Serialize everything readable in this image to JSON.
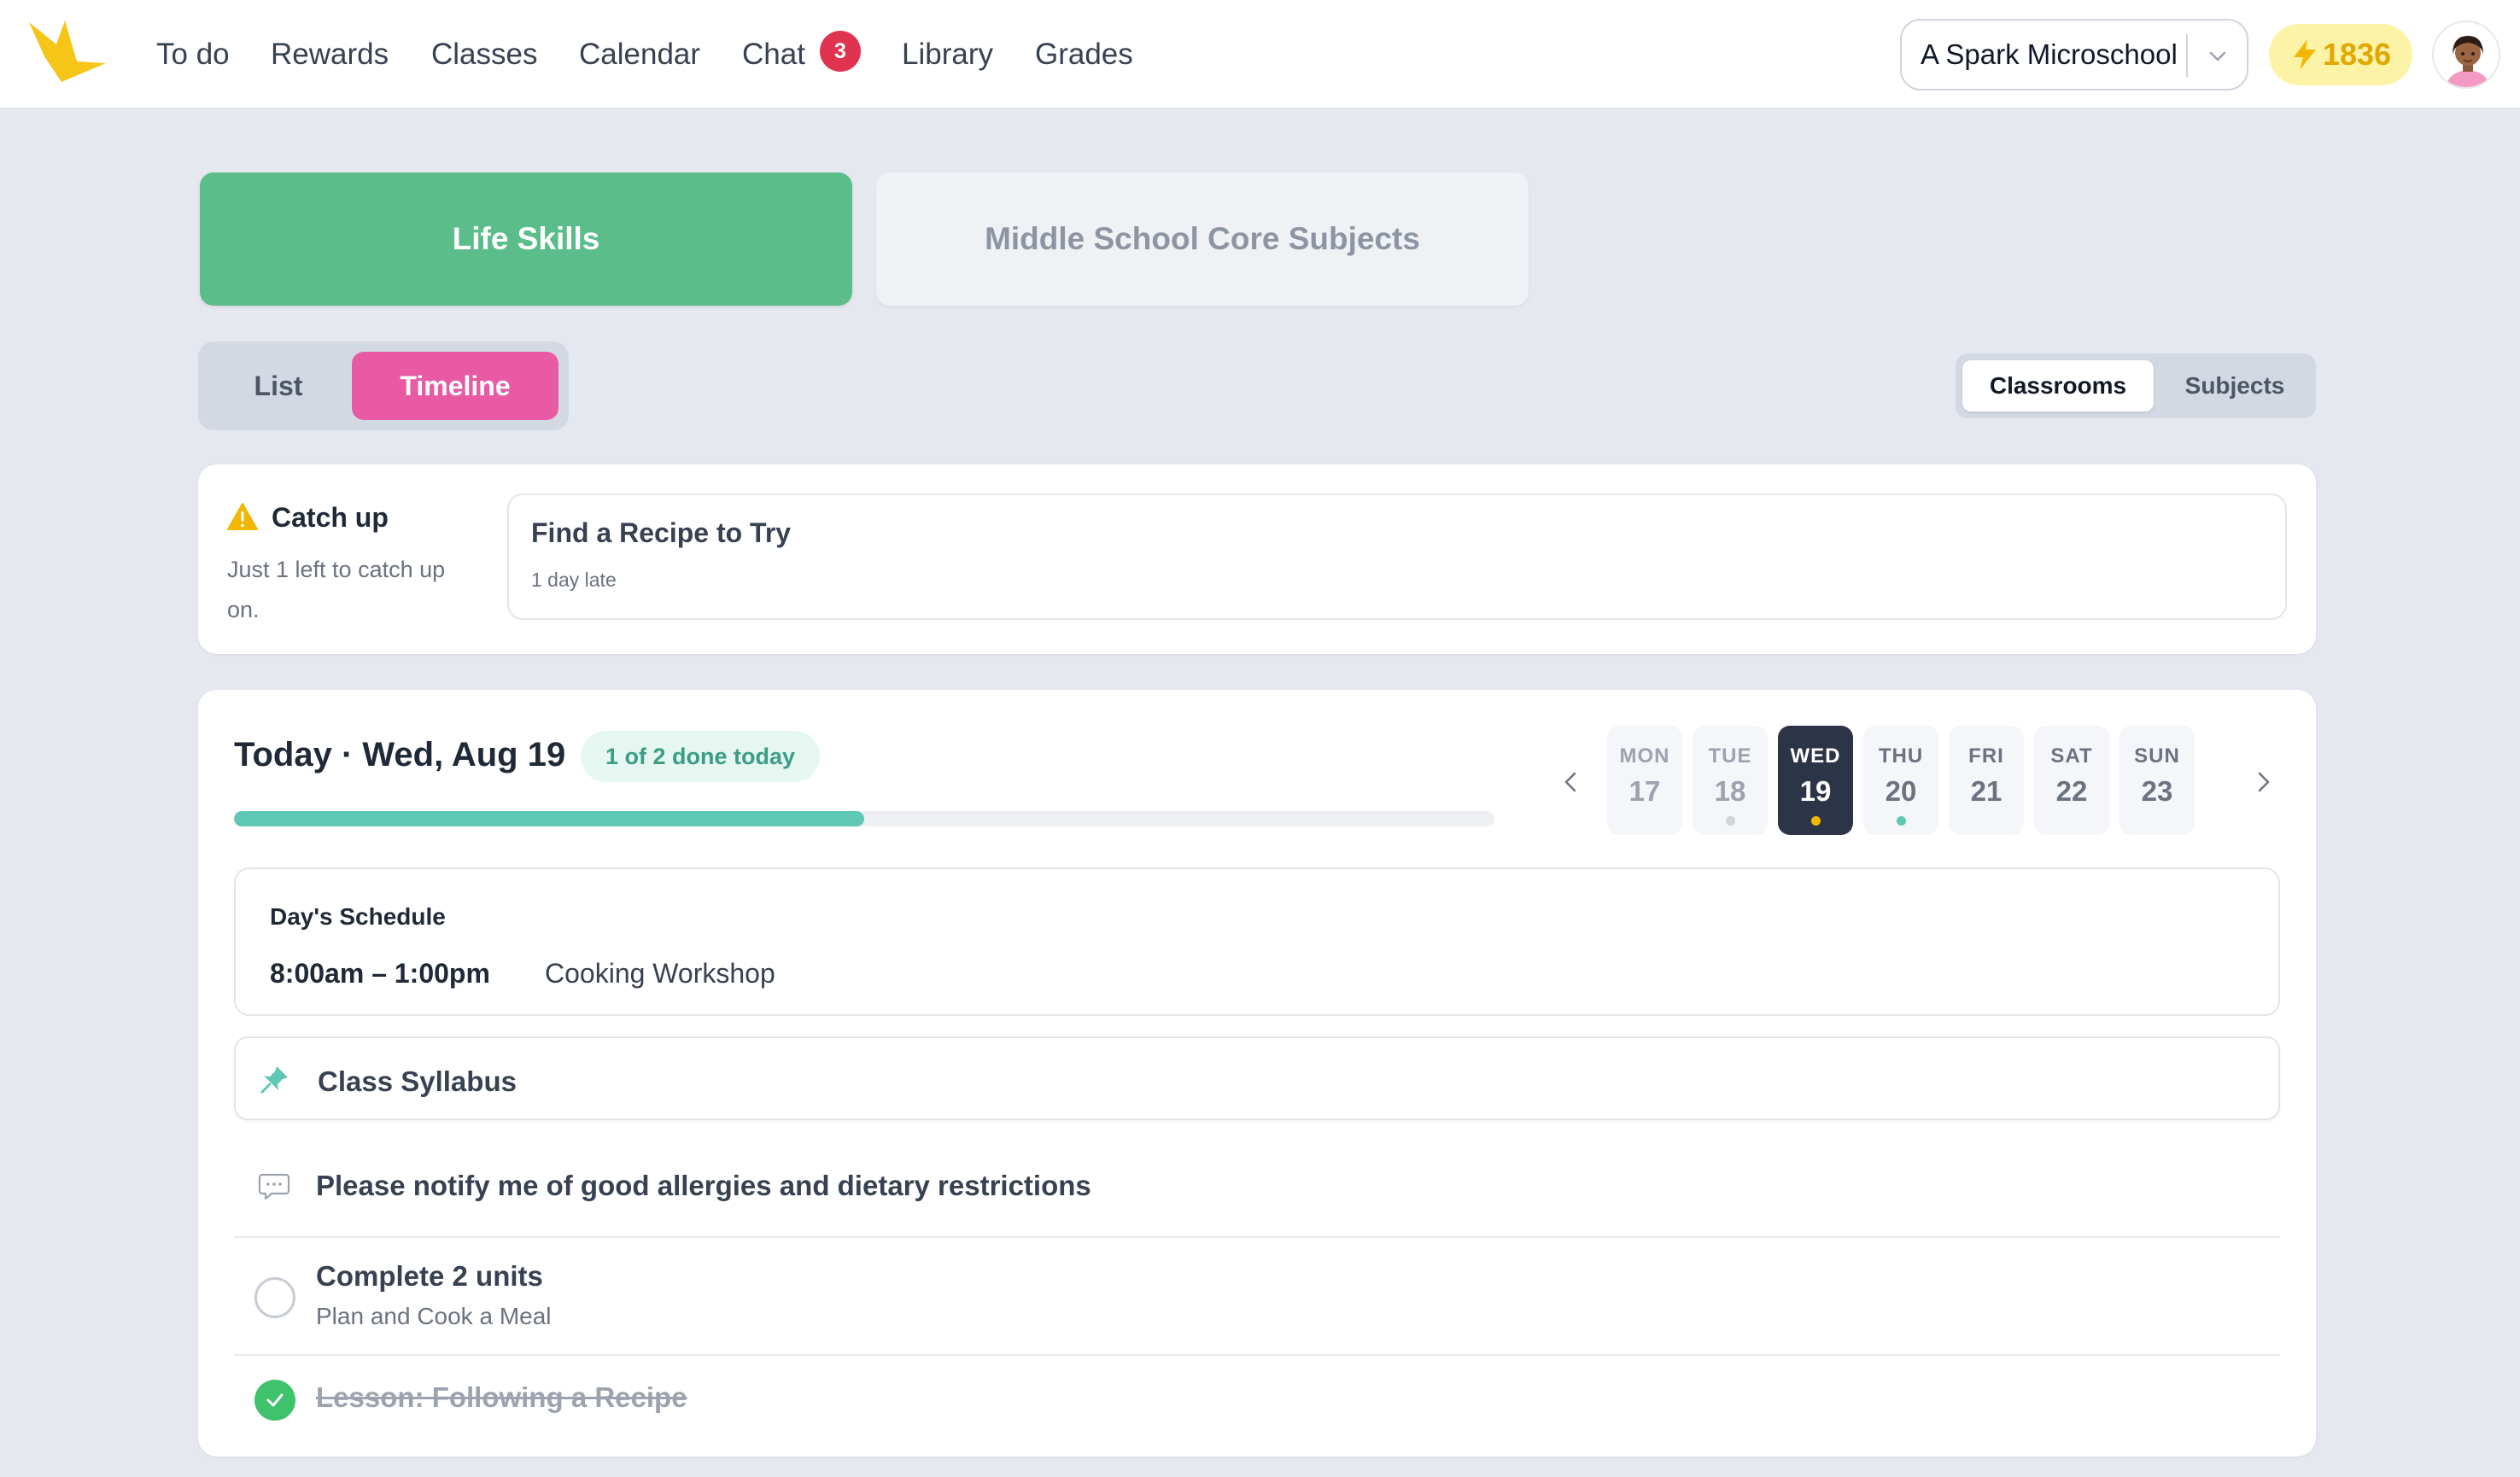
{
  "nav": {
    "items": [
      {
        "label": "To do"
      },
      {
        "label": "Rewards"
      },
      {
        "label": "Classes"
      },
      {
        "label": "Calendar"
      },
      {
        "label": "Chat",
        "badge": "3"
      },
      {
        "label": "Library"
      },
      {
        "label": "Grades"
      }
    ],
    "school_selector": "A Spark Microschool",
    "points": "1836",
    "colors": {
      "brand": "#f5c518",
      "badge": "#e0334f",
      "points_bg": "#fdf3a6",
      "points_text": "#e0a800"
    }
  },
  "programs": {
    "active": "Life Skills",
    "inactive": "Middle School Core Subjects",
    "active_color": "#5abd8a"
  },
  "view_toggle": {
    "list": "List",
    "timeline": "Timeline",
    "selected": "Timeline",
    "accent": "#e85aa4"
  },
  "group_toggle": {
    "classrooms": "Classrooms",
    "subjects": "Subjects",
    "selected": "Classrooms"
  },
  "catch_up": {
    "title": "Catch up",
    "description": "Just 1 left to catch up on.",
    "icon": "warning-icon",
    "item": {
      "title": "Find a Recipe to Try",
      "status": "1 day late"
    }
  },
  "today": {
    "title": "Today · Wed, Aug 19",
    "done_badge": "1 of 2 done today",
    "progress": 0.5,
    "days": [
      {
        "name": "MON",
        "num": "17",
        "state": "past",
        "dot": null
      },
      {
        "name": "TUE",
        "num": "18",
        "state": "past",
        "dot": "#d1d5db"
      },
      {
        "name": "WED",
        "num": "19",
        "state": "selected",
        "dot": "#f5b800"
      },
      {
        "name": "THU",
        "num": "20",
        "state": "future",
        "dot": "#5ec8b4"
      },
      {
        "name": "FRI",
        "num": "21",
        "state": "future",
        "dot": null
      },
      {
        "name": "SAT",
        "num": "22",
        "state": "future",
        "dot": null
      },
      {
        "name": "SUN",
        "num": "23",
        "state": "future",
        "dot": null
      }
    ],
    "schedule": {
      "title": "Day's Schedule",
      "time": "8:00am – 1:00pm",
      "name": "Cooking Workshop"
    },
    "syllabus": "Class Syllabus",
    "message": "Please notify me of good allergies and dietary restrictions",
    "task": {
      "title": "Complete 2 units",
      "subtitle": "Plan and Cook a Meal"
    },
    "completed_lesson": "Lesson: Following a Recipe"
  }
}
